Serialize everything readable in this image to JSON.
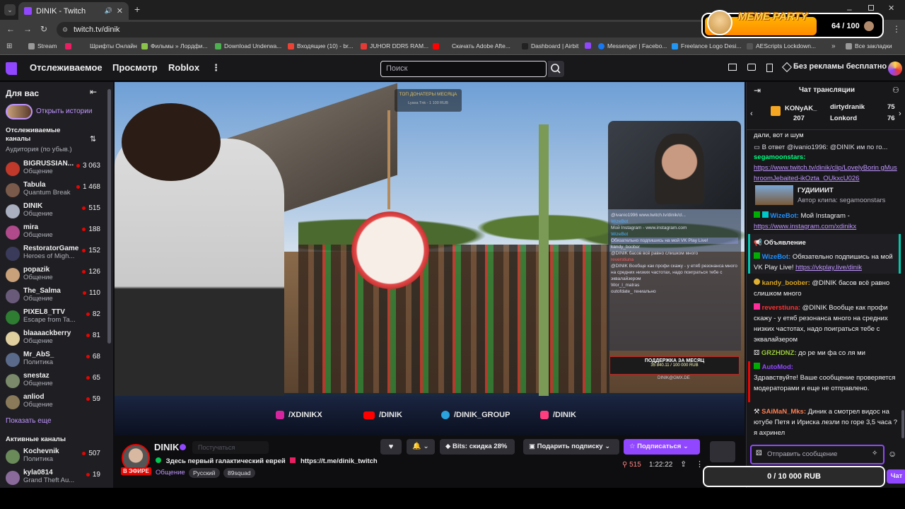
{
  "browser": {
    "tab_title": "DINIK - Twitch",
    "url": "twitch.tv/dinik",
    "bookmarks": [
      "Stream",
      "Шрифты Онлайн",
      "Фильмы » Лордфи...",
      "Download Underwa...",
      "Входящие (10) - br...",
      "JUHOR DDR5 RAM...",
      "Скачать Adobe Afte...",
      "Dashboard | Airbit",
      "Messenger | Facebo...",
      "Freelance Logo Desi...",
      "AEScripts Lockdown...",
      "Все закладки"
    ]
  },
  "overlay": {
    "meme_party": "MEME PARTY",
    "meme_counter": "64 / 100",
    "goal_bar": "0 / 10 000 RUB"
  },
  "nav": {
    "following": "Отслеживаемое",
    "browse": "Просмотр",
    "roblox": "Roblox",
    "search_placeholder": "Поиск",
    "ad_free": "Без рекламы бесплатно"
  },
  "sidebar": {
    "for_you": "Для вас",
    "open_stories": "Открыть истории",
    "followed_title": "Отслеживаемые каналы",
    "audience_sort": "Аудитория (по убыв.)",
    "channels": [
      {
        "name": "BIGRUSSIAN...",
        "cat": "Общение",
        "count": "3 063"
      },
      {
        "name": "Tabula",
        "cat": "Quantum Break",
        "count": "1 468"
      },
      {
        "name": "DINIK",
        "cat": "Общение",
        "count": "515"
      },
      {
        "name": "mira",
        "cat": "Общение",
        "count": "188"
      },
      {
        "name": "RestoratorGame",
        "cat": "Heroes of Migh...",
        "count": "152"
      },
      {
        "name": "popazik",
        "cat": "Общение",
        "count": "126"
      },
      {
        "name": "The_Salma",
        "cat": "Общение",
        "count": "110"
      },
      {
        "name": "PIXEL8_TTV",
        "cat": "Escape from Ta...",
        "count": "82"
      },
      {
        "name": "blaaaackberry",
        "cat": "Общение",
        "count": "81"
      },
      {
        "name": "Mr_AbS_",
        "cat": "Политика",
        "count": "68"
      },
      {
        "name": "snestaz",
        "cat": "Общение",
        "count": "65"
      },
      {
        "name": "anliod",
        "cat": "Общение",
        "count": "59"
      }
    ],
    "show_more": "Показать еще",
    "active_title": "Активные каналы",
    "active": [
      {
        "name": "Kochevnik",
        "cat": "Политика",
        "count": "507"
      },
      {
        "name": "kyla0814",
        "cat": "Grand Theft Au...",
        "count": "19"
      }
    ]
  },
  "video": {
    "top_donators": "ТОП ДОНАТЕРЫ МЕСЯЦА",
    "donator_line": "Lyaxa Tnk - 1 100 RUB",
    "socials": [
      "/XDINIKX",
      "/DINIK",
      "/DINIK_GROUP",
      "/DINIK"
    ],
    "support_title": "ПОДДЕРЖКА ЗА МЕСЯЦ",
    "support_value": "35 840.11 / 100 000 RUB",
    "email": "DINIK@GMX.DE",
    "mini_chat": [
      "@ivanio1996 www.twitch.tv/dinik/cl...",
      "WizeBot",
      "Мой Instagram - www.instagram.com",
      "WizeBot",
      "Обязательно подпишись на мой VK Play Live!",
      "kandy_boober",
      "@DINIK басов всё равно слишком много",
      "reverstiuna",
      "@DINIK Вообще как профи скажу - у етяб резонанса много на средних низких частотах, надо поиграться тебе с эквалайзером",
      "Wor_l_matras",
      "outofdate_ гениально"
    ]
  },
  "channel": {
    "name": "DINIK",
    "live": "В ЭФИРЕ",
    "following_btn": "Постучаться",
    "title_text": "Здесь первый галактический еврей",
    "title_link": "https://t.me/dinik_twitch",
    "category": "Общение",
    "tags": [
      "Русский",
      "89squad"
    ],
    "bits": "Bits: скидка 28%",
    "gift": "Подарить подписку",
    "subscribe": "Подписаться",
    "viewers": "515",
    "uptime": "1:22:22"
  },
  "chat": {
    "header": "Чат трансляции",
    "gifters": [
      {
        "name": "KONyAK_",
        "count": "207"
      },
      {
        "name": "dirtydranik",
        "count": "75"
      },
      {
        "name": "Lonkord",
        "count": "76"
      }
    ],
    "messages": [
      {
        "user": "",
        "text": "дали, вот и шум"
      },
      {
        "user": "",
        "text": "В ответ @ivanio1996: @DINIK им по го..."
      },
      {
        "user": "segamoonstars:",
        "text": ""
      },
      {
        "user": "",
        "text": "https://www.twitch.tv/dinik/clip/LovelyBorin gMushroomJebaited-ikOzta_OUkxcU026"
      },
      {
        "user": "ГУДИИИИТ",
        "text": "Автор клипа: segamoonstars"
      },
      {
        "user": "WizeBot:",
        "text": "Мой Instagram - "
      },
      {
        "user": "",
        "text": "https://www.instagram.com/xdinikx"
      },
      {
        "user": "Объявление",
        "text": ""
      },
      {
        "user": "WizeBot:",
        "text": "Обязательно подпишись на мой VK Play Live! "
      },
      {
        "user": "",
        "text": "https://vkplay.live/dinik"
      },
      {
        "user": "kandy_boober:",
        "text": "@DINIK басов всё равно слишком много"
      },
      {
        "user": "reverstiuna:",
        "text": "@DINIK Вообще как профи скажу - у етяб резонанса много на средних низких частотах, надо поиграться тебе с эквалайзером"
      },
      {
        "user": "GRZHDNZ:",
        "text": "до ре ми фа со ля ми"
      },
      {
        "user": "AutoMod:",
        "text": ""
      },
      {
        "user": "",
        "text": "Здравствуйте! Ваше сообщение проверяется модераторами и еще не отправлено."
      },
      {
        "user": "SAiMaN_Mks:",
        "text": "Диник а смотрел видос на ютубе Петя и Ириска лезли по горе 3,5 часа ? я ахринел"
      }
    ],
    "input_placeholder": "Отправить сообщение",
    "chat_btn": "Чат"
  }
}
